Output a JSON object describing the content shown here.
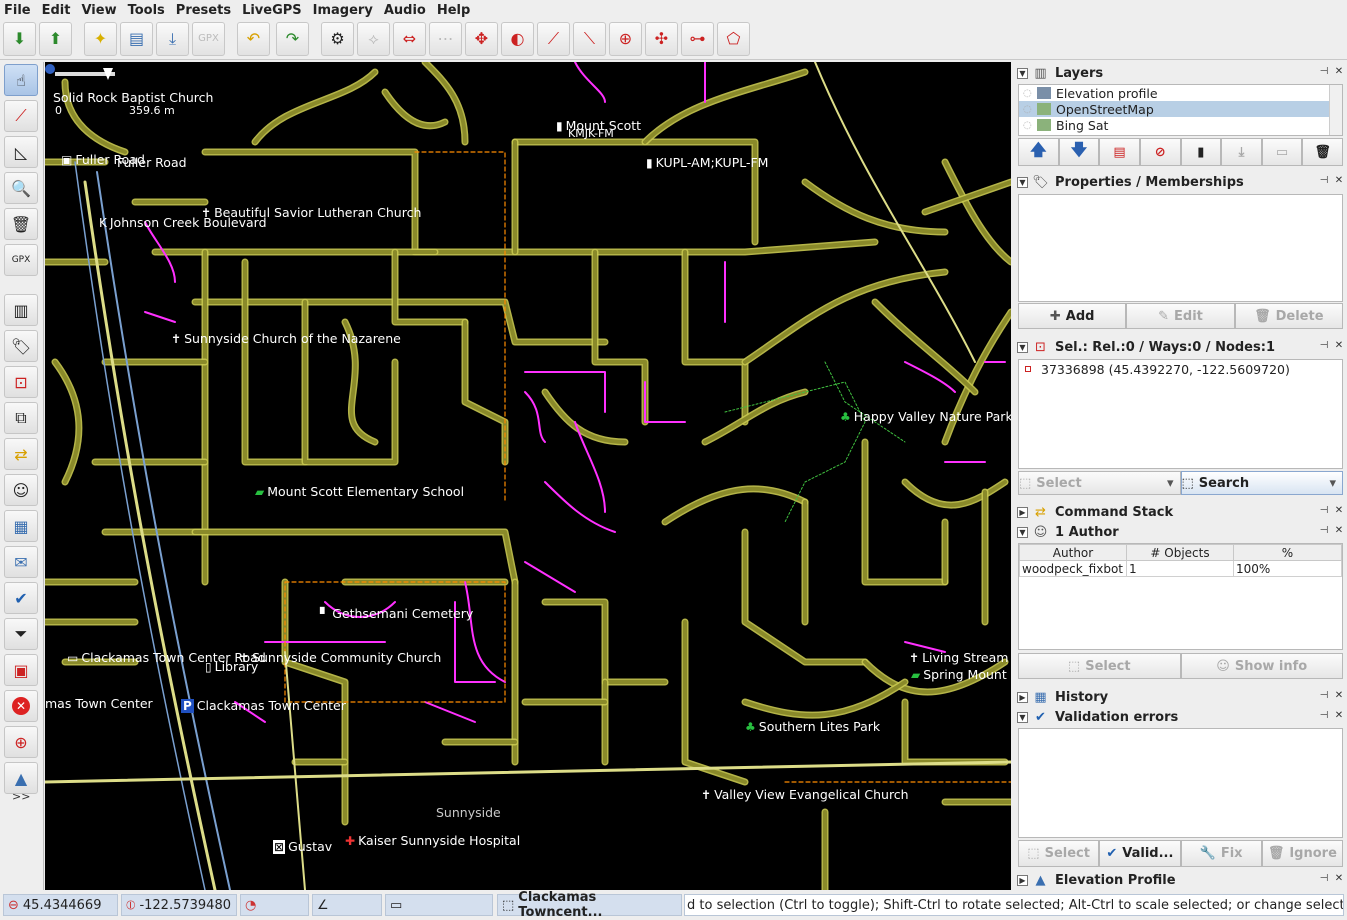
{
  "menu": [
    "File",
    "Edit",
    "View",
    "Tools",
    "Presets",
    "LiveGPS",
    "Imagery",
    "Audio",
    "Help"
  ],
  "map": {
    "scale_label": "0",
    "scale_distance": "359.6 m",
    "labels": [
      {
        "id": "solid-rock",
        "text": "Solid Rock Baptist Church"
      },
      {
        "id": "fuller-road-1",
        "text": "Fuller Road"
      },
      {
        "id": "fuller-road-2",
        "text": "Fuller Road"
      },
      {
        "id": "mount-scott",
        "text": "Mount Scott"
      },
      {
        "id": "kmjk",
        "text": "KMJK-FM"
      },
      {
        "id": "kupl",
        "text": "KUPL-AM;KUPL-FM"
      },
      {
        "id": "beautiful-savior",
        "text": "Beautiful Savior Lutheran Church"
      },
      {
        "id": "johnson-creek",
        "text": "Johnson Creek Boulevard"
      },
      {
        "id": "sunnyside-church",
        "text": "Sunnyside Church of the Nazarene"
      },
      {
        "id": "happy-valley",
        "text": "Happy Valley Nature Park"
      },
      {
        "id": "mount-scott-school",
        "text": "Mount Scott Elementary School"
      },
      {
        "id": "gethsemani",
        "text": "Gethsemani Cemetery"
      },
      {
        "id": "clackamas-tc-road",
        "text": "Clackamas Town Center Road"
      },
      {
        "id": "sunnyside-community",
        "text": "Sunnyside Community Church"
      },
      {
        "id": "library",
        "text": "Library"
      },
      {
        "id": "living-stream",
        "text": "Living Stream"
      },
      {
        "id": "spring-mount",
        "text": "Spring Mount"
      },
      {
        "id": "mas-town-center",
        "text": "mas Town Center"
      },
      {
        "id": "clackamas-town-center",
        "text": "Clackamas Town Center"
      },
      {
        "id": "southern-lites",
        "text": "Southern Lites Park"
      },
      {
        "id": "sunnyside",
        "text": "Sunnyside"
      },
      {
        "id": "valley-view",
        "text": "Valley View Evangelical Church"
      },
      {
        "id": "kaiser",
        "text": "Kaiser Sunnyside Hospital"
      },
      {
        "id": "gustav",
        "text": "Gustav"
      }
    ]
  },
  "layers": {
    "title": "Layers",
    "items": [
      {
        "name": "Elevation profile",
        "selected": false
      },
      {
        "name": "OpenStreetMap",
        "selected": true
      },
      {
        "name": "Bing Sat",
        "selected": false
      }
    ]
  },
  "properties": {
    "title": "Properties / Memberships",
    "add": "Add",
    "edit": "Edit",
    "delete": "Delete"
  },
  "selection": {
    "title": "Sel.: Rel.:0 / Ways:0 / Nodes:1",
    "item": "37336898 (45.4392270, -122.5609720)",
    "select": "Select",
    "search": "Search"
  },
  "command_stack": {
    "title": "Command Stack"
  },
  "authors": {
    "title": "1 Author",
    "columns": [
      "Author",
      "# Objects",
      "%"
    ],
    "rows": [
      {
        "author": "woodpeck_fixbot",
        "objects": "1",
        "percent": "100%"
      }
    ],
    "select": "Select",
    "show_info": "Show info"
  },
  "history": {
    "title": "History"
  },
  "validation": {
    "title": "Validation errors",
    "select": "Select",
    "validate": "Valid...",
    "fix": "Fix",
    "ignore": "Ignore"
  },
  "elevation": {
    "title": "Elevation Profile"
  },
  "status": {
    "lat": "45.4344669",
    "lon": "-122.5739480",
    "name": "Clackamas Towncent...",
    "message": "d to selection (Ctrl to toggle); Shift-Ctrl to rotate selected; Alt-Ctrl to scale selected; or change selection"
  },
  "colors": {
    "road": "#8a8a2a",
    "road_outline": "#c8c850",
    "footway": "#ff30ff",
    "highway": "#dddd88",
    "rail": "#7aa0d0",
    "boundary": "#ff8c00"
  }
}
